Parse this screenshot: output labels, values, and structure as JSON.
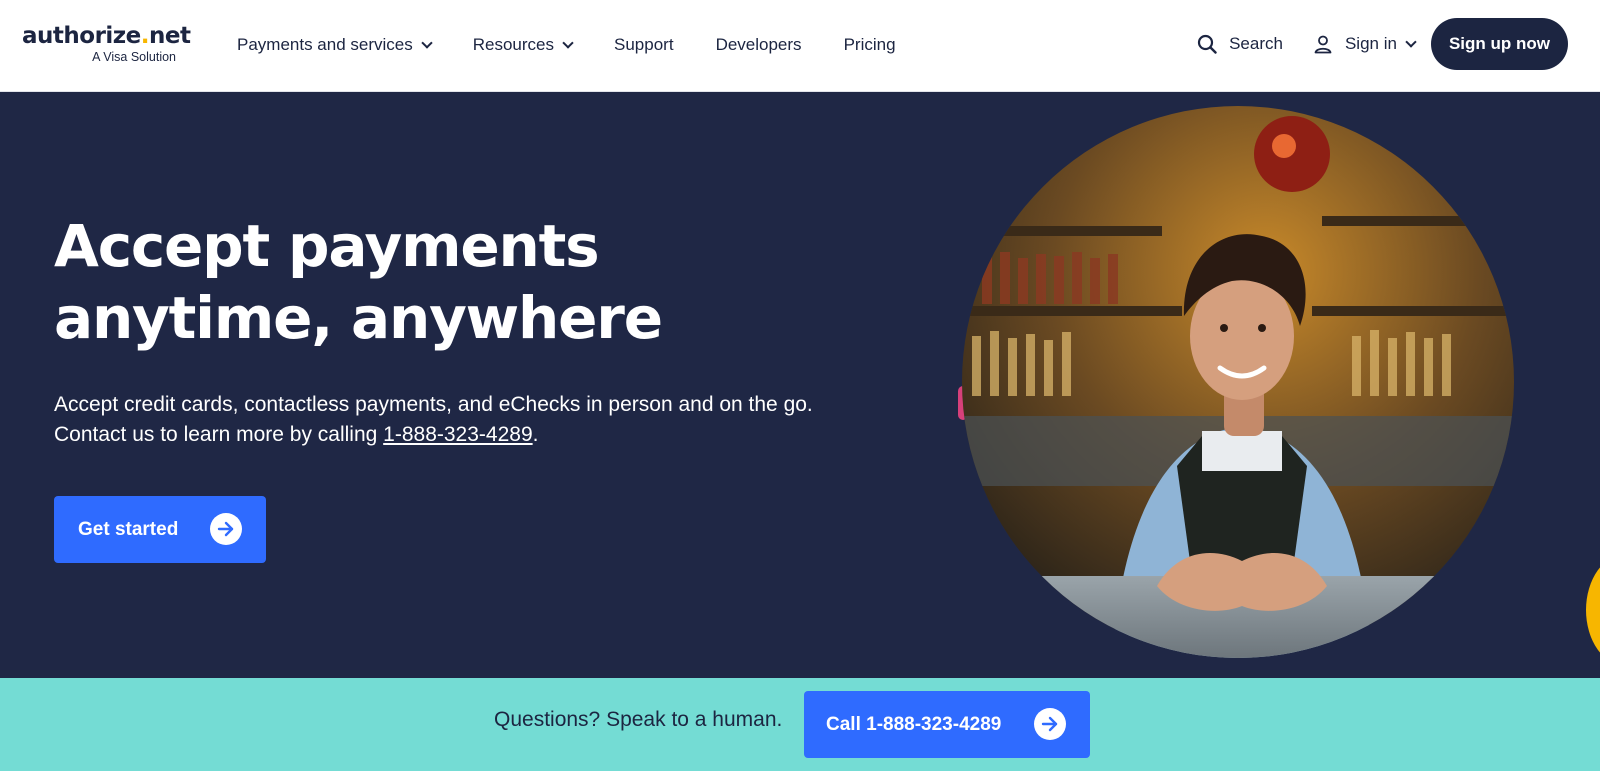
{
  "header": {
    "logo": {
      "main": "authorize",
      "dot": ".",
      "ext": "net",
      "sub": "A Visa Solution"
    },
    "nav": [
      {
        "label": "Payments and services",
        "has_dropdown": true
      },
      {
        "label": "Resources",
        "has_dropdown": true
      },
      {
        "label": "Support",
        "has_dropdown": false
      },
      {
        "label": "Developers",
        "has_dropdown": false
      },
      {
        "label": "Pricing",
        "has_dropdown": false
      }
    ],
    "search_label": "Search",
    "signin_label": "Sign in",
    "signup_label": "Sign up now",
    "icons": {
      "search": "search-icon",
      "user": "user-icon",
      "chevron": "chevron-down-icon"
    }
  },
  "hero": {
    "title": "Accept payments anytime, anywhere",
    "desc_line1": "Accept credit cards, contactless payments, and eChecks in person and on the go.",
    "desc_line2_prefix": "Contact us to learn more by calling ",
    "phone": "1-888-323-4289",
    "desc_line2_suffix": ".",
    "cta_label": "Get started",
    "icons": {
      "cta": "arrow-right-icon"
    }
  },
  "banner": {
    "text": "Questions? Speak to a human.",
    "call_label": "Call 1-888-323-4289",
    "icons": {
      "call": "arrow-right-icon"
    }
  },
  "colors": {
    "navy": "#1c2541",
    "hero_bg": "#1f2745",
    "accent_blue": "#2f6bff",
    "teal_banner": "#74dcd4",
    "logo_dot": "#f7b600"
  }
}
